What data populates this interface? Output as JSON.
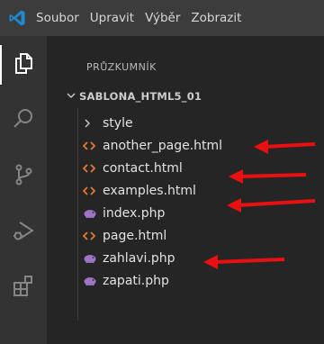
{
  "menu": [
    "Soubor",
    "Upravit",
    "Výběr",
    "Zobrazit"
  ],
  "activity_bar": [
    {
      "icon": "files-icon",
      "active": true
    },
    {
      "icon": "search-icon",
      "active": false
    },
    {
      "icon": "source-control-icon",
      "active": false
    },
    {
      "icon": "run-debug-icon",
      "active": false
    },
    {
      "icon": "extensions-icon",
      "active": false
    }
  ],
  "explorer": {
    "title": "PRŮZKUMNÍK",
    "folder": "SABLONA_HTML5_01",
    "folder_chevron": "⌄",
    "items": [
      {
        "label": "style",
        "kind": "folder",
        "icon": "chevron-right-icon"
      },
      {
        "label": "another_page.html",
        "kind": "html",
        "icon": "html-file-icon"
      },
      {
        "label": "contact.html",
        "kind": "html",
        "icon": "html-file-icon"
      },
      {
        "label": "examples.html",
        "kind": "html",
        "icon": "html-file-icon"
      },
      {
        "label": "index.php",
        "kind": "php",
        "icon": "php-file-icon"
      },
      {
        "label": "page.html",
        "kind": "html",
        "icon": "html-file-icon"
      },
      {
        "label": "zahlavi.php",
        "kind": "php",
        "icon": "php-file-icon"
      },
      {
        "label": "zapati.php",
        "kind": "php",
        "icon": "php-file-icon"
      }
    ]
  },
  "colors": {
    "html_icon": "#e37933",
    "php_icon": "#a074c4",
    "annotation_arrow": "#e81010",
    "titlebar": "#3c3c3c",
    "activitybar": "#333333",
    "sidebar": "#252526"
  }
}
